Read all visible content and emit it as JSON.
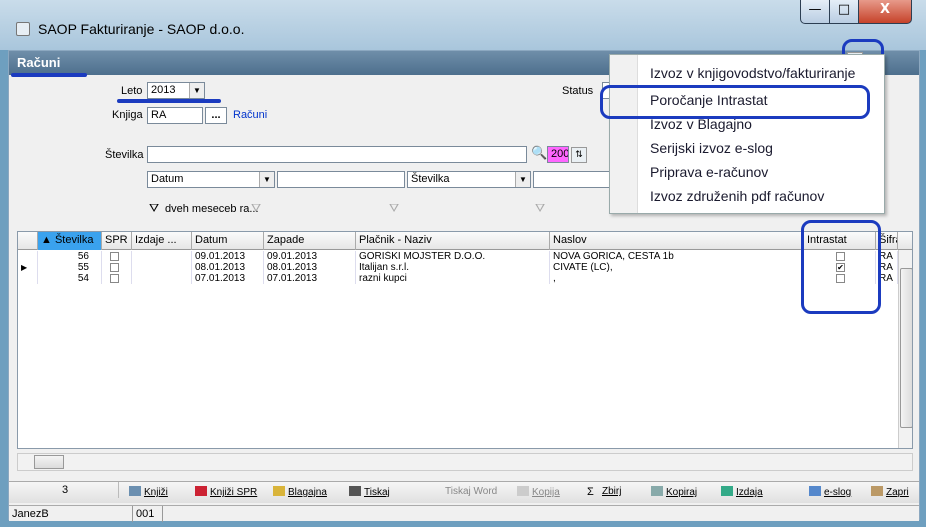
{
  "window": {
    "title": "SAOP Fakturiranje - SAOP d.o.o.",
    "min": "—",
    "max": "□",
    "close": "X"
  },
  "header": {
    "title": "Računi"
  },
  "filters": {
    "leto_label": "Leto",
    "leto_value": "2013",
    "knjiga_label": "Knjiga",
    "knjiga_value": "RA",
    "knjiga_browse": "...",
    "knjiga_link": "Računi",
    "stevilka_label": "Številka",
    "stevilka_value": "",
    "count": "200",
    "sort1": "Datum",
    "sort1_text": "",
    "sort2": "Številka",
    "sort2_text": "",
    "status_label": "Status",
    "filter_text": "dveh meseceb ra..."
  },
  "grid": {
    "columns": [
      "▲ Številka",
      "SPR",
      "Izdaje ...",
      "Datum",
      "Zapade",
      "Plačnik - Naziv",
      "Naslov",
      "Intrastat",
      "Šifra"
    ],
    "rows": [
      {
        "num": "56",
        "spr": false,
        "izdaje": "",
        "datum": "09.01.2013",
        "zapade": "09.01.2013",
        "placnik": "GORIŠKI MOJSTER  D.O.O.",
        "naslov": "NOVA GORICA, CESTA 1b",
        "intrastat": false,
        "sifra": "RA"
      },
      {
        "num": "55",
        "spr": false,
        "izdaje": "",
        "datum": "08.01.2013",
        "zapade": "08.01.2013",
        "placnik": "Italijan s.r.l.",
        "naslov": "CIVATE (LC),",
        "intrastat": true,
        "sifra": "RA"
      },
      {
        "num": "54",
        "spr": false,
        "izdaje": "",
        "datum": "07.01.2013",
        "zapade": "07.01.2013",
        "placnik": "razni kupci",
        "naslov": ",",
        "intrastat": false,
        "sifra": "RA"
      }
    ],
    "check_mark": "✔"
  },
  "toolbar": {
    "count": "3",
    "items": [
      "Knjiži",
      "Knjiži SPR",
      "Blagajna",
      "Tiskaj",
      "Tiskaj Word",
      "Kopija",
      "Zbirj",
      "Kopiraj",
      "Izdaja",
      "e-slog",
      "Zapri"
    ]
  },
  "statusbar": {
    "user": "JanezB",
    "code": "001"
  },
  "menu": {
    "items": [
      "Izvoz v knjigovodstvo/fakturiranje",
      "Poročanje Intrastat",
      "Izvoz v Blagajno",
      "Serijski izvoz e-slog",
      "Priprava e-računov",
      "Izvoz združenih pdf računov"
    ]
  },
  "colors": {
    "annotation": "#1b3bbf",
    "header_bar": "#4d6f8d",
    "count_badge": "#ff66ff"
  }
}
